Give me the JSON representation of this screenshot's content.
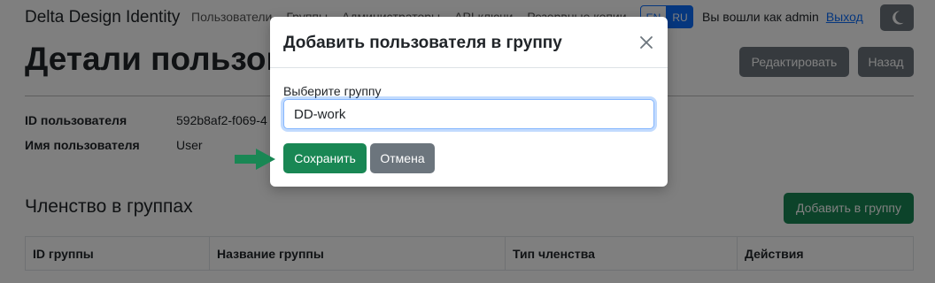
{
  "navbar": {
    "brand": "Delta Design Identity",
    "links": [
      "Пользователи",
      "Группы",
      "Администраторы",
      "API ключи",
      "Резервные копии"
    ],
    "lang_en": "EN",
    "lang_ru": "RU",
    "logged_in": "Вы вошли как admin",
    "logout": "Выход",
    "theme_icon": "moon-icon"
  },
  "page": {
    "title": "Детали пользователя",
    "edit_button": "Редактировать",
    "back_button": "Назад",
    "details": [
      {
        "label": "ID пользователя",
        "value": "592b8af2-f069-4"
      },
      {
        "label": "Имя пользователя",
        "value": "User"
      }
    ],
    "groups_section_title": "Членство в группах",
    "add_to_group_button": "Добавить в группу",
    "table_headers": [
      "ID группы",
      "Название группы",
      "Тип членства",
      "Действия"
    ]
  },
  "modal": {
    "title": "Добавить пользователя в группу",
    "field_label": "Выберите группу",
    "field_value": "DD-work",
    "save_button": "Сохранить",
    "cancel_button": "Отмена",
    "close_icon": "close-icon"
  },
  "colors": {
    "primary": "#0d6efd",
    "success": "#198754",
    "secondary": "#6c757d",
    "arrow": "#198754"
  }
}
